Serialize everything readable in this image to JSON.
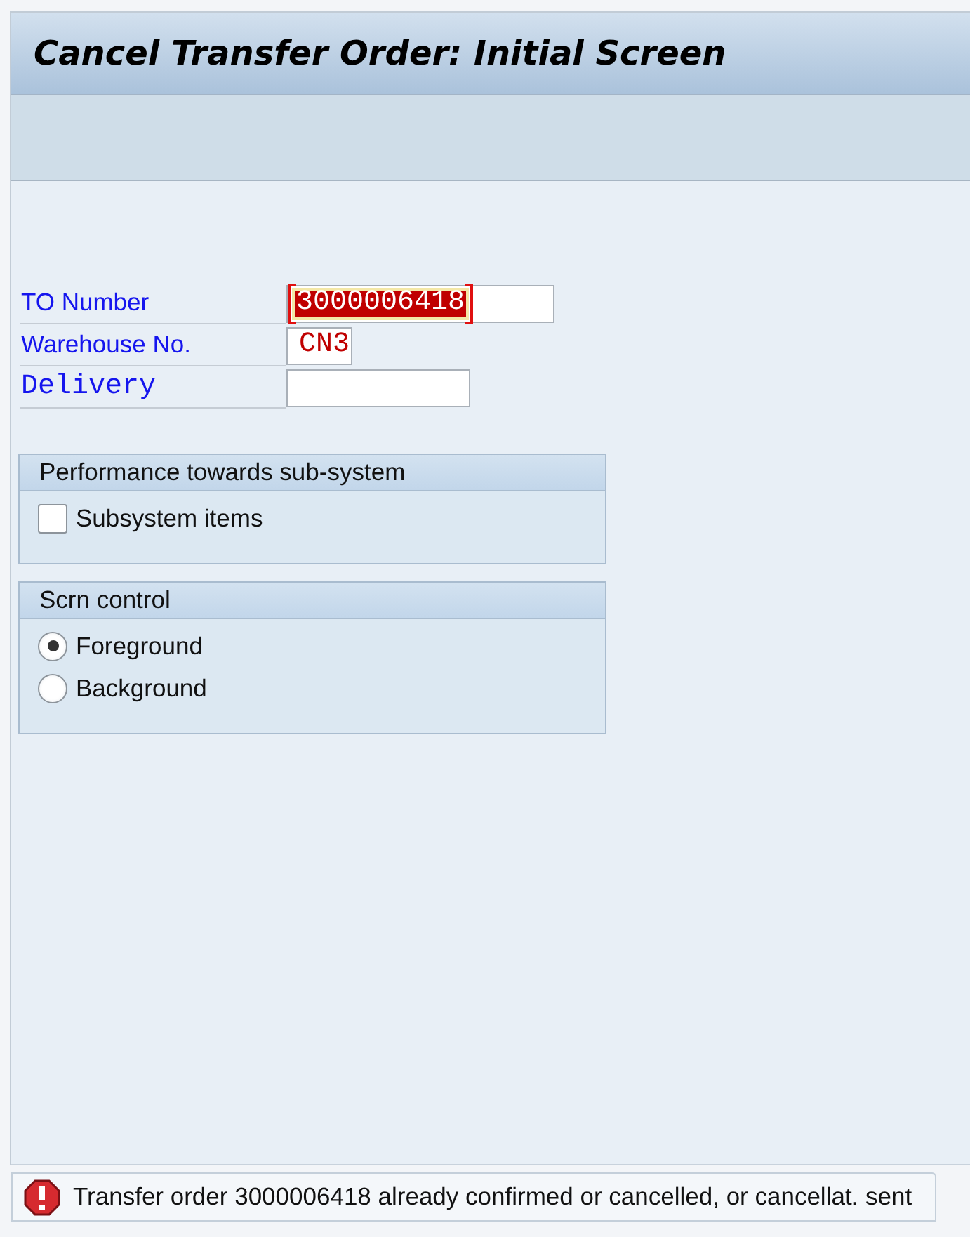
{
  "window": {
    "title": "Cancel Transfer Order: Initial Screen"
  },
  "fields": [
    {
      "label": "TO Number",
      "value": "3000006418",
      "error": true
    },
    {
      "label": "Warehouse No.",
      "value": "CN3",
      "error": false
    },
    {
      "label": "Delivery",
      "error": false
    }
  ],
  "groups": [
    {
      "title": "Performance towards sub-system",
      "options": [
        {
          "kind": "checkbox",
          "label": "Subsystem items",
          "checked": false
        }
      ]
    },
    {
      "title": "Scrn control",
      "options": [
        {
          "kind": "radio",
          "label": "Foreground",
          "selected": true
        },
        {
          "kind": "radio",
          "label": "Background",
          "selected": false
        }
      ]
    }
  ],
  "status_bar": {
    "error": true,
    "message": "Transfer order 3000006418 already confirmed or cancelled, or cancellat. sent"
  }
}
